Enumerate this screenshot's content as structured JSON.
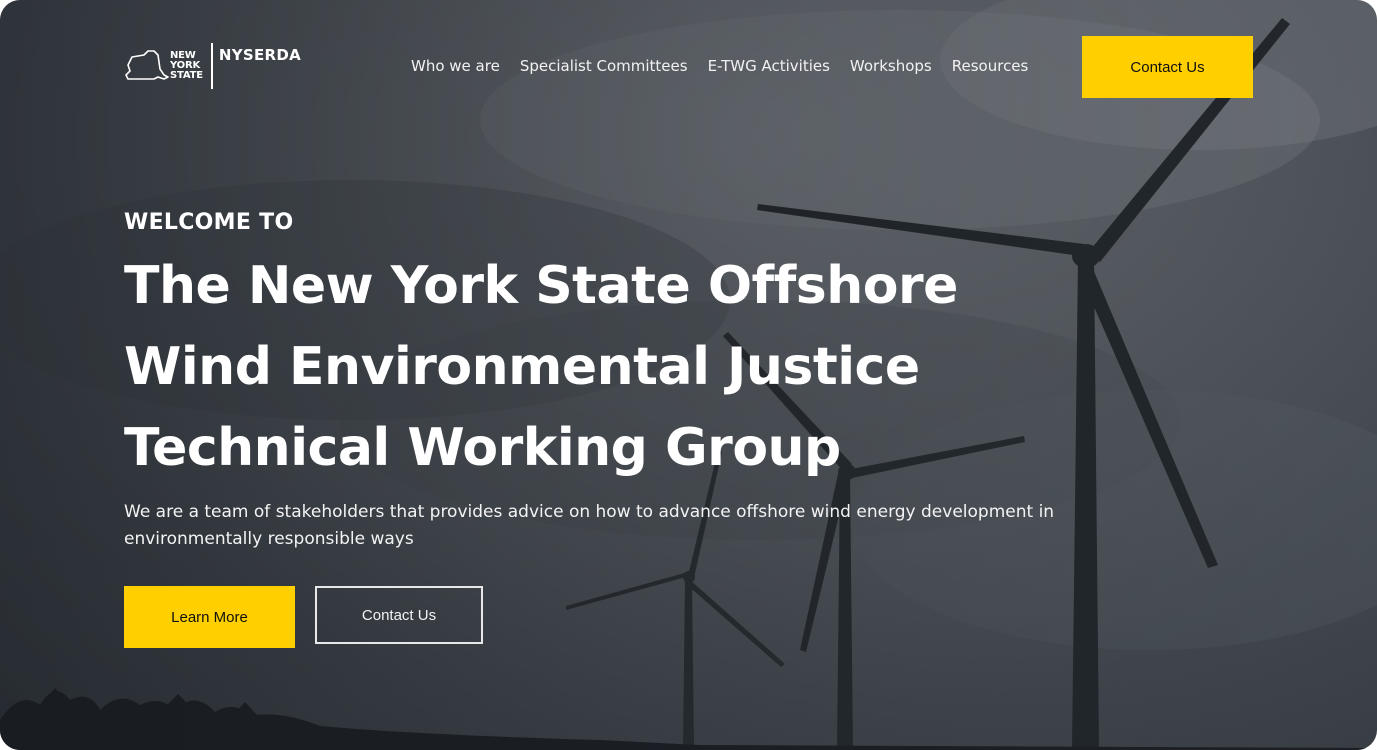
{
  "brand": {
    "state_lines": [
      "NEW",
      "YORK",
      "STATE"
    ],
    "agency": "NYSERDA"
  },
  "nav": {
    "items": [
      {
        "label": "Who we are"
      },
      {
        "label": "Specialist Committees"
      },
      {
        "label": "E-TWG Activities"
      },
      {
        "label": "Workshops"
      },
      {
        "label": "Resources"
      }
    ],
    "cta_label": "Contact Us"
  },
  "hero": {
    "eyebrow": "WELCOME TO",
    "title": "The New York State Offshore Wind Environmental Justice Technical Working Group",
    "description": "We are a team of stakeholders that provides advice on how to advance offshore wind energy development in environmentally responsible ways",
    "primary_button": "Learn More",
    "secondary_button": "Contact Us"
  },
  "colors": {
    "accent": "#ffcf00",
    "text_on_dark": "#ffffff"
  }
}
